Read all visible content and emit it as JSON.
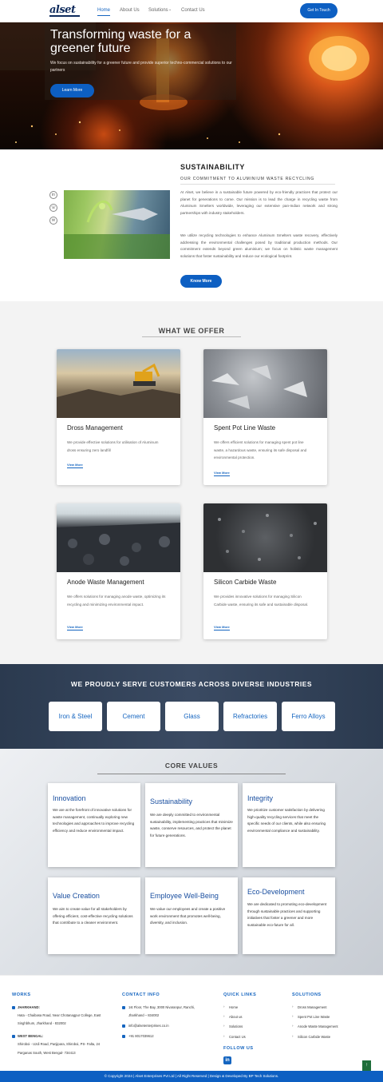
{
  "nav": {
    "logo": "alset",
    "links": [
      "Home",
      "About Us",
      "Solutions",
      "Contact Us"
    ],
    "solutions_caret": "⌄",
    "cta": "Get In Touch"
  },
  "hero": {
    "title": "Transforming waste for a greener future",
    "subtitle": "We focus on sustainability for a greener future and provide superior techno-commercial solutions to our partners",
    "cta": "Learn More"
  },
  "social": [
    "in",
    "☏",
    "✉"
  ],
  "sustainability": {
    "title": "SUSTAINABILITY",
    "subtitle": "OUR COMMITMENT TO ALUMINIUM WASTE RECYCLING",
    "p1": "At Alset, we believe in a sustainable future powered by eco-friendly practices that protect our planet for generations to come. Our mission is to lead the charge in recycling waste from Aluminum Smelters worldwide, leveraging our extensive pan-Indian network and strong partnerships with industry stakeholders.",
    "p2": "We utilize recycling technologies to enhance Aluminum Smelters waste recovery, effectively addressing the environmental challenges posed by traditional production methods. Our commitment extends beyond green aluminium; we focus on holistic waste management solutions that foster sustainability and reduce our ecological footprint.",
    "cta": "Know More"
  },
  "offer": {
    "title": "WHAT WE OFFER",
    "cards": [
      {
        "title": "Dross Management",
        "desc": "We provide effective solutions for utilisation of Aluminum dross ensuring zero landfill",
        "link": "View More"
      },
      {
        "title": "Spent Pot Line Waste",
        "desc": "We offers efficient solutions for managing spent pot line waste, a hazardous waste, ensuring its safe disposal and environmental protection.",
        "link": "View More"
      },
      {
        "title": "Anode Waste Management",
        "desc": "We offers solutions for managing anode waste, optimizing its recycling and minimizing environmental impact.",
        "link": "View More"
      },
      {
        "title": "Silicon Carbide Waste",
        "desc": "We provides innovative solutions for managing Silicon Carbide waste, ensuring its safe and sustainable disposal.",
        "link": "View More"
      }
    ]
  },
  "industries": {
    "title": "WE PROUDLY SERVE CUSTOMERS ACROSS DIVERSE INDUSTRIES",
    "items": [
      "Iron & Steel",
      "Cement",
      "Glass",
      "Refractories",
      "Ferro Alloys"
    ]
  },
  "core": {
    "title": "CORE VALUES",
    "items": [
      {
        "title": "Innovation",
        "desc": "We are at the forefront of innovative solutions for waste management, continually exploring new technologies and approaches to improve recycling efficiency and reduce environmental impact."
      },
      {
        "title": "Sustainability",
        "desc": "We are deeply committed to environmental sustainability, implementing practices that minimize waste, conserve resources, and protect the planet for future generations."
      },
      {
        "title": "Integrity",
        "desc": "We prioritize customer satisfaction by delivering high-quality recycling services that meet the specific needs of our clients, while also ensuring environmental compliance and sustainability."
      },
      {
        "title": "Value Creation",
        "desc": "We aim to create value for all stakeholders by offering efficient, cost-effective recycling solutions that contribute to a cleaner environment."
      },
      {
        "title": "Employee Well-Being",
        "desc": "We value our employees and create a positive work environment that promotes well-being, diversity, and inclusion."
      },
      {
        "title": "Eco-Development",
        "desc": "We are dedicated to promoting eco-development through sustainable practices and supporting initiatives that foster a greener and more sustainable eco-future for all."
      }
    ]
  },
  "footer": {
    "works": {
      "heading": "WORKS",
      "loc1_label": "JHARKHAND:",
      "loc1_lines": [
        "Hata - Chaibasa Road, Near Chotanagpur College, East",
        "Singhbhum, Jharkhand - 832002"
      ],
      "loc2_label": "WEST BENGAL:",
      "loc2_lines": [
        "Shiroboi - Uzdi Road, Panjipara, Shiroboi, PS- Falta, 24",
        "Parganas South, West Bengal- 734413"
      ]
    },
    "contact": {
      "heading": "CONTACT INFO",
      "address": [
        "1st Floor, The Bay, 3000 Nivaranpur, Ranchi,",
        "Jharkhand – 834002"
      ],
      "email": "info@alsetenterprises.co.in",
      "phone": "+91 8017039612"
    },
    "quick": {
      "heading": "QUICK LINKS",
      "items": [
        "Home",
        "About us",
        "Solutions",
        "Contact Us"
      ]
    },
    "follow": {
      "heading": "FOLLOW US",
      "icon": "in"
    },
    "solutions": {
      "heading": "SOLUTIONS",
      "items": [
        "Dross Management",
        "Spent Pot Line Waste",
        "Anode Waste Management",
        "Silicon Carbide Waste"
      ]
    },
    "copyright": "© Copyright 2024 | Alset Enterprises Pvt Ltd | All Right Reserved | Design & Developed By BP Tech Solutions.",
    "to_top": "↑"
  },
  "colors": {
    "brand": "#0d5fc2",
    "dark": "#2b3a4f",
    "title_blue": "#1a4fa0"
  }
}
